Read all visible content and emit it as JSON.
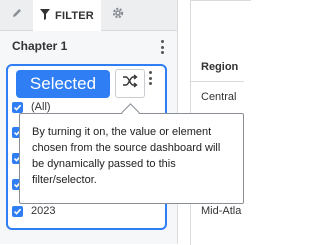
{
  "tabs": {
    "filter_label": "FILTER",
    "pencil_icon": "pencil-icon",
    "filter_icon": "funnel-icon",
    "gear_icon": "gear-icon"
  },
  "panel": {
    "title": "Chapter 1"
  },
  "card": {
    "selected_label": "Selected",
    "shuffle_icon": "shuffle-icon",
    "options": [
      {
        "label": "(All)",
        "checked": true
      },
      {
        "label": "",
        "checked": true
      },
      {
        "label": "",
        "checked": true
      },
      {
        "label": "",
        "checked": true
      },
      {
        "label": "2023",
        "checked": true
      }
    ]
  },
  "tooltip": {
    "text": "By turning it on, the value or element chosen from the source dashboard will be dynamically passed to this filter/selector."
  },
  "table": {
    "header": "Region",
    "rows": [
      "Central",
      "Mid-Atla"
    ]
  },
  "colors": {
    "accent": "#2f7ef3",
    "panel_bg": "#f6f7f8",
    "border": "#d9dcdf"
  }
}
